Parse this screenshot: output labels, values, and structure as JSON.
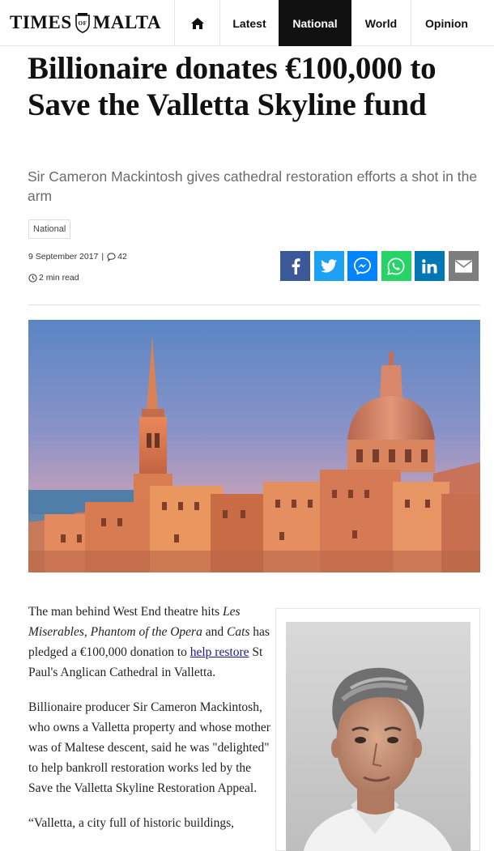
{
  "brand": {
    "logo_left": "TIMES",
    "logo_mid": "OF",
    "logo_right": "MALTA"
  },
  "nav": {
    "home_icon": "home-icon",
    "items": [
      {
        "label": "Latest"
      },
      {
        "label": "National"
      },
      {
        "label": "World"
      },
      {
        "label": "Opinion"
      }
    ],
    "active": "National"
  },
  "article": {
    "title": "Billionaire donates €100,000 to Save the Valletta Skyline fund",
    "subtitle": "Sir Cameron Mackintosh gives cathedral restoration efforts a shot in the arm",
    "tag": "National",
    "date": "9 September 2017",
    "comment_count": "42",
    "read_time": "2 min read",
    "body": {
      "p1_a": "The man behind West End theatre hits ",
      "p1_em1": "Les Miserables",
      "p1_b": ", ",
      "p1_em2": "Phantom of the Opera",
      "p1_c": " and ",
      "p1_em3": "Cats",
      "p1_d": " has pledged a €100,000 donation to ",
      "p1_link": "help restore",
      "p1_e": " St Paul's Anglican Cathedral in Valletta.",
      "p2": "Billionaire producer Sir Cameron Mackintosh, who owns a Valletta property and whose mother was of Maltese descent, said he was \"delighted\" to help bankroll restoration works led by the Save the Valletta Skyline Restoration Appeal.",
      "p3": "“Valletta, a city full of historic buildings,"
    }
  },
  "share": [
    {
      "name": "facebook-icon",
      "color": "#3b5998"
    },
    {
      "name": "twitter-icon",
      "color": "#1da1f2"
    },
    {
      "name": "messenger-icon",
      "color": "#0084ff"
    },
    {
      "name": "whatsapp-icon",
      "color": "#25d366"
    },
    {
      "name": "linkedin-icon",
      "color": "#0077b5"
    },
    {
      "name": "email-icon",
      "color": "#7d7d7d"
    }
  ],
  "colors": {
    "nav_active_bg": "#111111",
    "link": "#1a1a8c",
    "subtitle": "#6b6b6b"
  }
}
